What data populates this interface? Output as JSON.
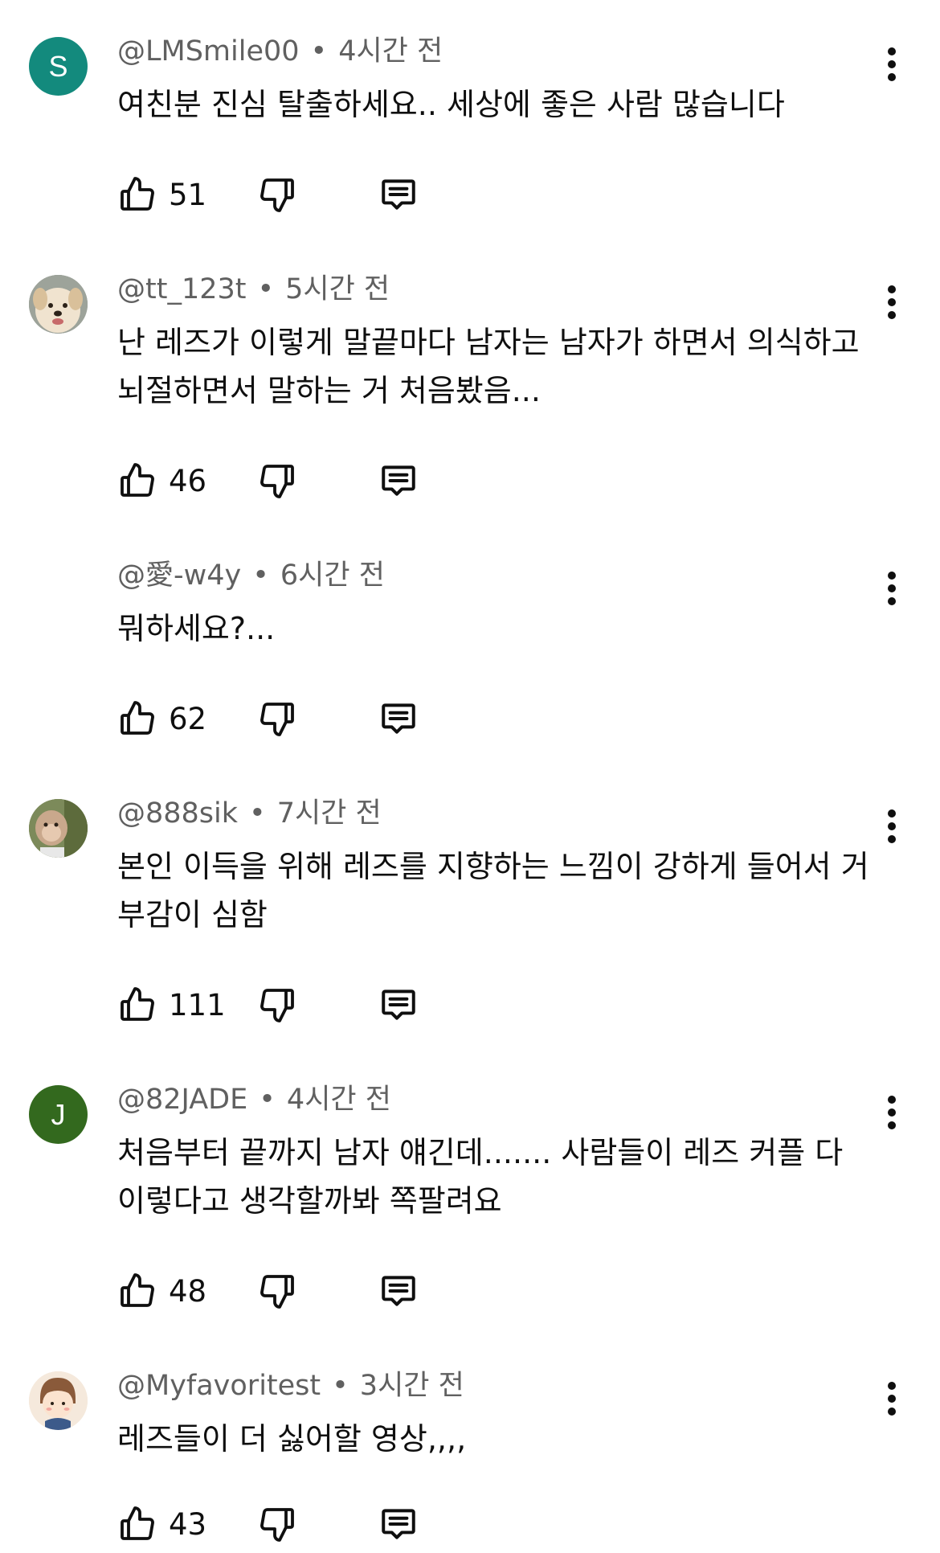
{
  "comments": [
    {
      "handle": "@LMSmile00",
      "time": "4시간 전",
      "text": "여친분 진심 탈출하세요.. 세상에 좋은 사람 많습니다",
      "likes": "51",
      "avatar": {
        "type": "letter",
        "letter": "S",
        "color": "#138a7d"
      }
    },
    {
      "handle": "@tt_123t",
      "time": "5시간 전",
      "text": "난 레즈가 이렇게 말끝마다 남자는 남자가 하면서 의식하고 뇌절하면서 말하는 거 처음봤음...",
      "likes": "46",
      "avatar": {
        "type": "dog-photo"
      }
    },
    {
      "handle": "@愛-w4y",
      "time": "6시간 전",
      "text": "뭐하세요?...",
      "likes": "62",
      "avatar": {
        "type": "none"
      }
    },
    {
      "handle": "@888sik",
      "time": "7시간 전",
      "text": "본인 이득을 위해 레즈를 지향하는 느낌이 강하게 들어서 거부감이 심함",
      "likes": "111",
      "avatar": {
        "type": "monkey-photo"
      }
    },
    {
      "handle": "@82JADE",
      "time": "4시간 전",
      "text": "처음부터 끝까지 남자 얘긴데....... 사람들이 레즈 커플 다 이렇다고 생각할까봐 쪽팔려요",
      "likes": "48",
      "avatar": {
        "type": "letter",
        "letter": "J",
        "color": "#33691e"
      }
    },
    {
      "handle": "@Myfavoritest",
      "time": "3시간 전",
      "text": "레즈들이 더 싫어할 영상,,,,",
      "likes": "43",
      "avatar": {
        "type": "cartoon-person"
      }
    }
  ],
  "icons": {
    "like": "thumbs-up-icon",
    "dislike": "thumbs-down-icon",
    "reply": "reply-comment-icon",
    "more": "more-vert-icon"
  }
}
